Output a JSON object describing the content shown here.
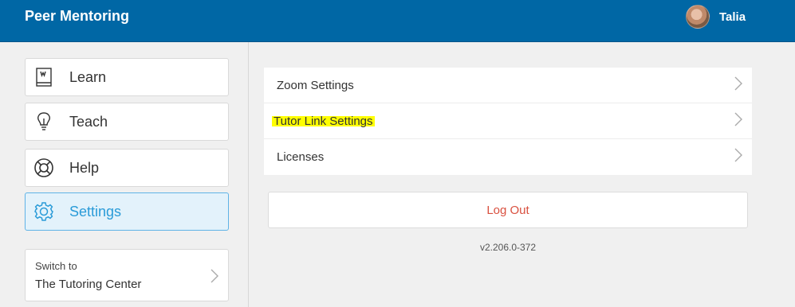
{
  "header": {
    "title": "Peer Mentoring",
    "user_name": "Talia"
  },
  "sidebar": {
    "items": [
      {
        "label": "Learn",
        "icon": "book-icon"
      },
      {
        "label": "Teach",
        "icon": "lightbulb-icon"
      },
      {
        "label": "Help",
        "icon": "lifebuoy-icon"
      },
      {
        "label": "Settings",
        "icon": "gear-icon",
        "active": true
      }
    ],
    "switch": {
      "caption": "Switch to",
      "target": "The Tutoring Center"
    }
  },
  "settings": {
    "rows": [
      {
        "label": "Zoom Settings"
      },
      {
        "label": "Tutor Link Settings",
        "highlighted": true
      },
      {
        "label": "Licenses"
      }
    ],
    "logout_label": "Log Out",
    "version": "v2.206.0-372"
  },
  "colors": {
    "header": "#0067a5",
    "active": "#2a9bd8",
    "logout": "#d9503f",
    "highlight": "#ffff00"
  }
}
